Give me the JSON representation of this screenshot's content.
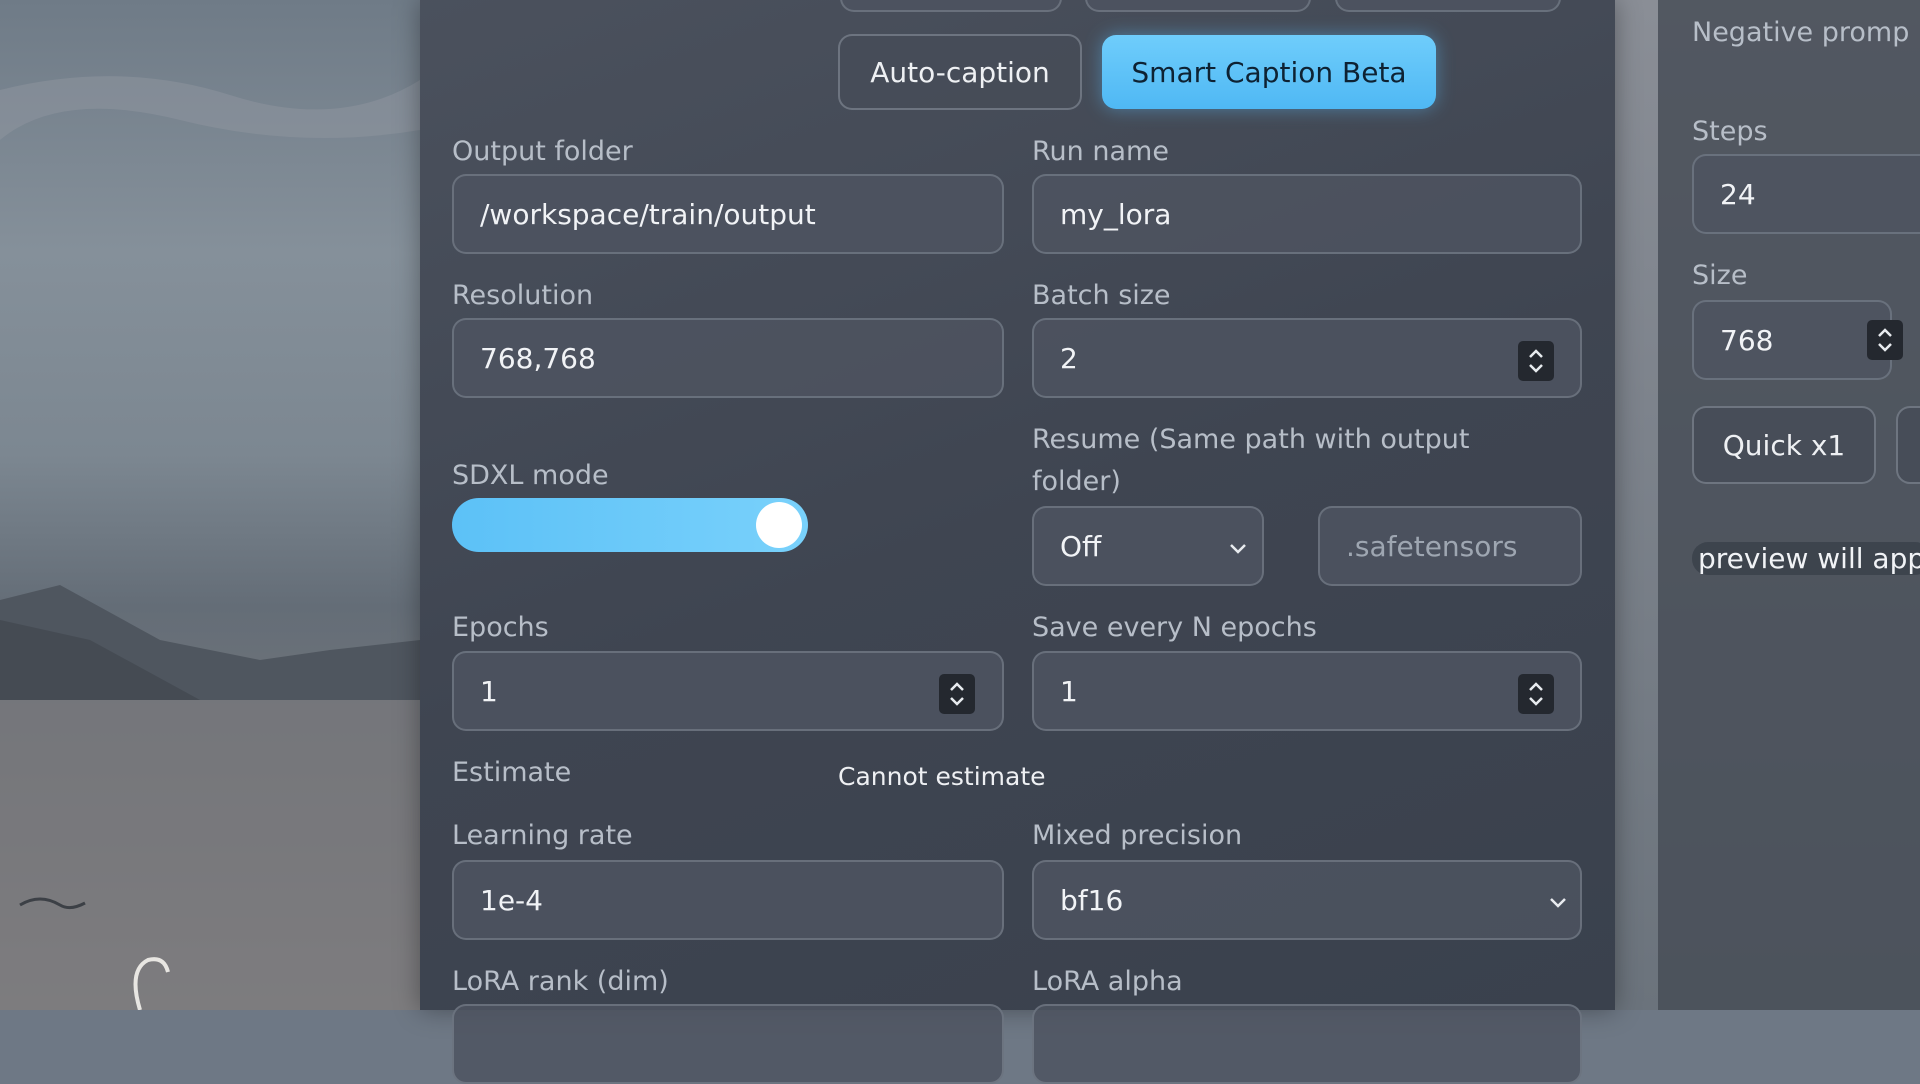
{
  "colors": {
    "accent": "#5cc1f7",
    "panel": "#3e4452",
    "field_bg": "#4e5460"
  },
  "captioning": {
    "auto_caption_label": "Auto-caption",
    "smart_caption_label": "Smart Caption Beta"
  },
  "form": {
    "output_folder": {
      "label": "Output folder",
      "value": "/workspace/train/output"
    },
    "run_name": {
      "label": "Run name",
      "value": "my_lora"
    },
    "resolution": {
      "label": "Resolution",
      "value": "768,768"
    },
    "batch_size": {
      "label": "Batch size",
      "value": "2"
    },
    "sdxl_mode": {
      "label": "SDXL mode",
      "enabled": true
    },
    "resume": {
      "label_line1": "Resume (Same path with output",
      "label_line2": "folder)",
      "selected": "Off",
      "ext_placeholder": ".safetensors"
    },
    "epochs": {
      "label": "Epochs",
      "value": "1"
    },
    "save_every": {
      "label": "Save every N epochs",
      "value": "1"
    },
    "estimate": {
      "label": "Estimate",
      "value": "Cannot estimate"
    },
    "learning_rate": {
      "label": "Learning rate",
      "value": "1e-4"
    },
    "mixed_precision": {
      "label": "Mixed precision",
      "selected": "bf16"
    },
    "lora_rank": {
      "label": "LoRA rank (dim)"
    },
    "lora_alpha": {
      "label": "LoRA alpha"
    }
  },
  "preview_panel": {
    "negative_prompt_label": "Negative promp",
    "steps_label": "Steps",
    "steps_value": "24",
    "size_label": "Size",
    "size_value": "768",
    "quick_button": "Quick x1",
    "preview_text": "preview will app"
  }
}
